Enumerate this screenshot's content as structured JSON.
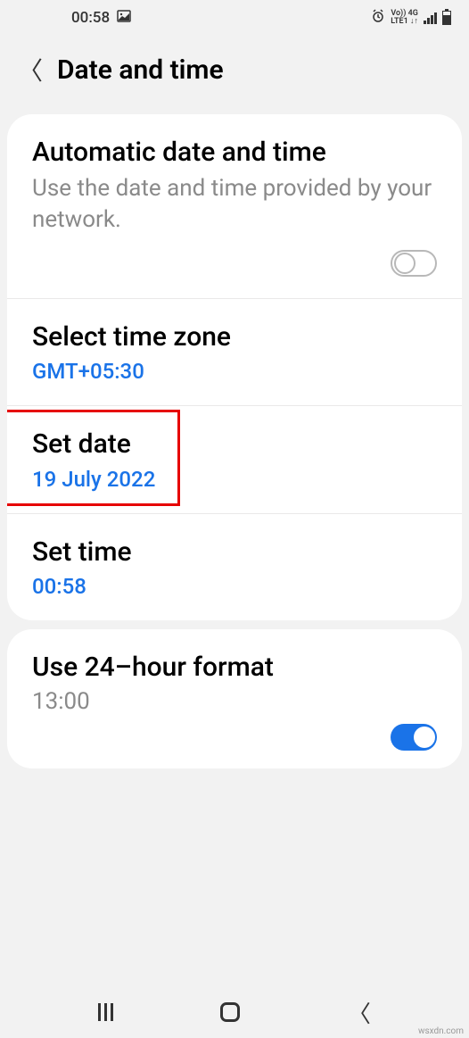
{
  "statusBar": {
    "time": "00:58",
    "lteLine1": "Vo))  4G",
    "lteLine2": "LTE1 ↓↑"
  },
  "header": {
    "title": "Date and time"
  },
  "autoDate": {
    "title": "Automatic date and time",
    "subtitle": "Use the date and time provided by your network."
  },
  "timezone": {
    "title": "Select time zone",
    "value": "GMT+05:30"
  },
  "setDate": {
    "title": "Set date",
    "value": "19 July 2022"
  },
  "setTime": {
    "title": "Set time",
    "value": "00:58"
  },
  "hourFormat": {
    "title": "Use 24–hour format",
    "value": "13:00"
  },
  "watermark": "wsxdn.com"
}
